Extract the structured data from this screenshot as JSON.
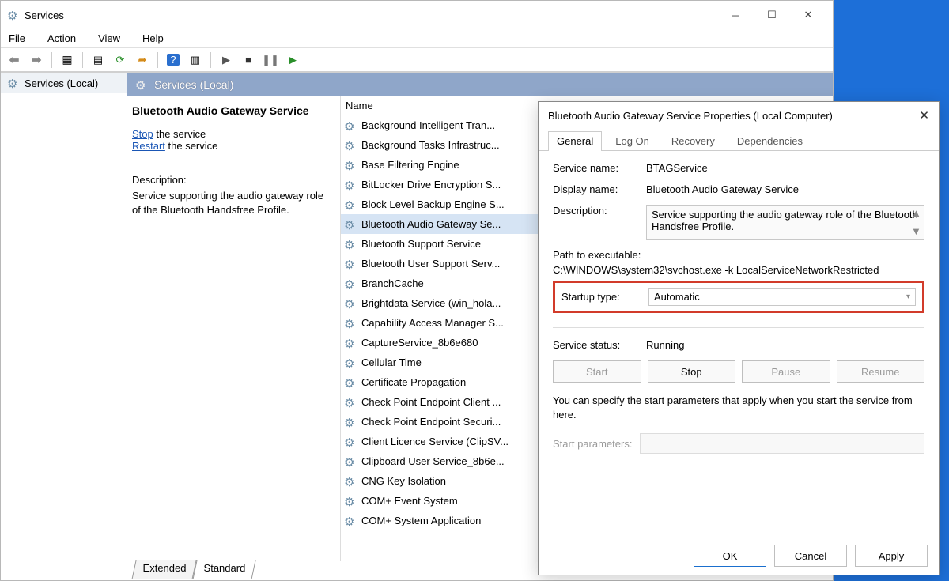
{
  "window": {
    "title": "Services",
    "menus": [
      "File",
      "Action",
      "View",
      "Help"
    ],
    "tree_item": "Services (Local)",
    "content_header": "Services (Local)"
  },
  "detail": {
    "name": "Bluetooth Audio Gateway Service",
    "stop_link": "Stop",
    "stop_suffix": " the service",
    "restart_link": "Restart",
    "restart_suffix": " the service",
    "desc_label": "Description:",
    "desc_text": "Service supporting the audio gateway role of the Bluetooth Handsfree Profile."
  },
  "list": {
    "col_name": "Name",
    "rows": [
      "Background Intelligent Tran...",
      "Background Tasks Infrastruc...",
      "Base Filtering Engine",
      "BitLocker Drive Encryption S...",
      "Block Level Backup Engine S...",
      "Bluetooth Audio Gateway Se...",
      "Bluetooth Support Service",
      "Bluetooth User Support Serv...",
      "BranchCache",
      "Brightdata Service (win_hola...",
      "Capability Access Manager S...",
      "CaptureService_8b6e680",
      "Cellular Time",
      "Certificate Propagation",
      "Check Point Endpoint Client ...",
      "Check Point Endpoint Securi...",
      "Client Licence Service (ClipSV...",
      "Clipboard User Service_8b6e...",
      "CNG Key Isolation",
      "COM+ Event System",
      "COM+ System Application"
    ],
    "selected_index": 5
  },
  "footer_tabs": {
    "extended": "Extended",
    "standard": "Standard"
  },
  "props": {
    "title": "Bluetooth Audio Gateway Service Properties (Local Computer)",
    "tabs": [
      "General",
      "Log On",
      "Recovery",
      "Dependencies"
    ],
    "active_tab": 0,
    "rows": {
      "service_name_lab": "Service name:",
      "service_name_val": "BTAGService",
      "display_name_lab": "Display name:",
      "display_name_val": "Bluetooth Audio Gateway Service",
      "description_lab": "Description:",
      "description_val": "Service supporting the audio gateway role of the Bluetooth Handsfree Profile.",
      "path_lab": "Path to executable:",
      "path_val": "C:\\WINDOWS\\system32\\svchost.exe -k LocalServiceNetworkRestricted",
      "startup_lab": "Startup type:",
      "startup_val": "Automatic",
      "status_lab": "Service status:",
      "status_val": "Running"
    },
    "buttons": {
      "start": "Start",
      "stop": "Stop",
      "pause": "Pause",
      "resume": "Resume"
    },
    "hint": "You can specify the start parameters that apply when you start the service from here.",
    "start_params_lab": "Start parameters:",
    "footer": {
      "ok": "OK",
      "cancel": "Cancel",
      "apply": "Apply"
    }
  }
}
